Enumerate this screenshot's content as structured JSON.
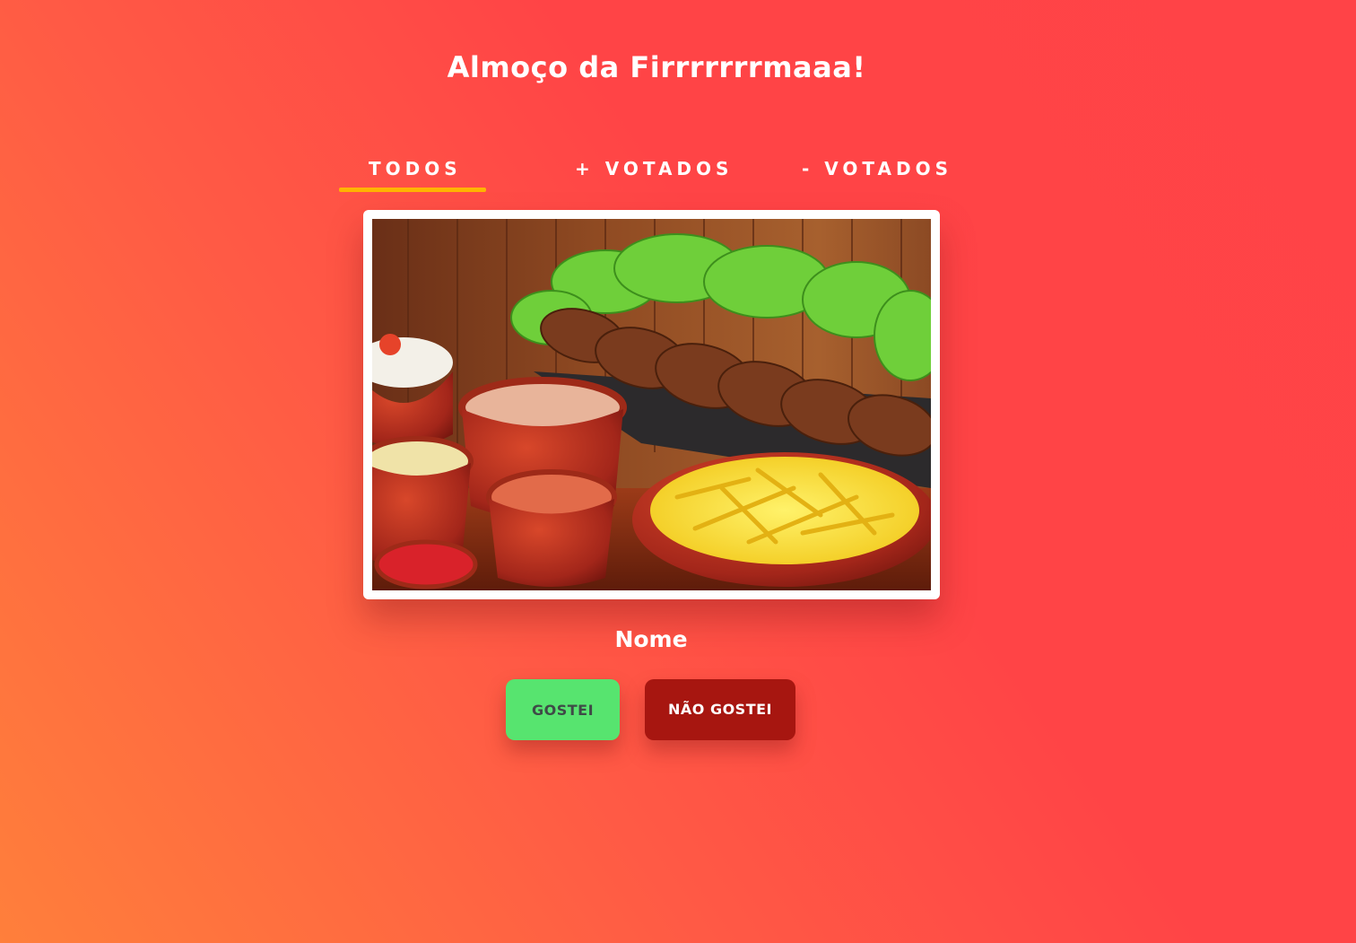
{
  "header": {
    "title": "Almoço da Firrrrrrrmaaa!"
  },
  "tabs": [
    {
      "label": "TODOS",
      "active": true
    },
    {
      "label": "+ VOTADOS",
      "active": false
    },
    {
      "label": "- VOTADOS",
      "active": false
    }
  ],
  "item": {
    "image_subject": "food-photo",
    "name": "Nome"
  },
  "actions": {
    "like_label": "GOSTEI",
    "dislike_label": "NÃO GOSTEI"
  },
  "colors": {
    "accent_underline": "#ffb400",
    "like_button": "#57e46f",
    "dislike_button": "#a71610",
    "background_start": "#ff7f3b",
    "background_end": "#ff4347"
  }
}
